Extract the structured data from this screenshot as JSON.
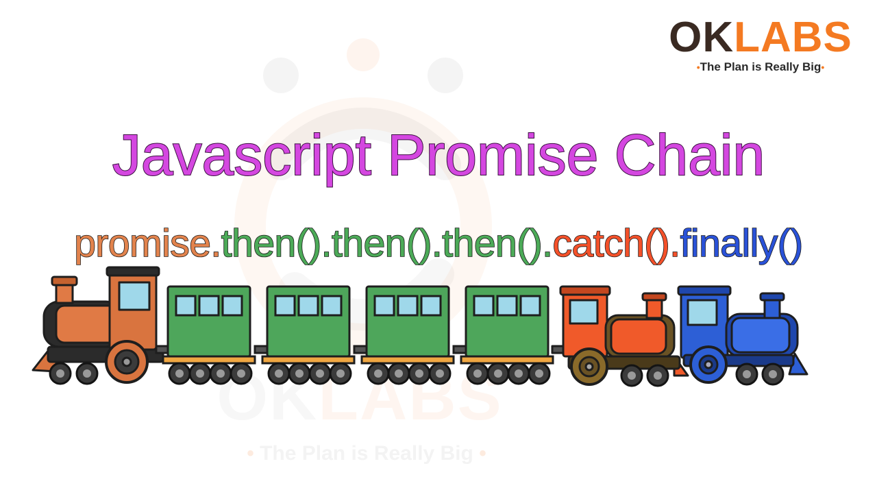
{
  "brand": {
    "name_part1": "OK",
    "name_part2": "LABS",
    "dot_left": "•",
    "tagline": "The Plan is Really Big",
    "dot_right": "•",
    "colors": {
      "dark": "#3a2a22",
      "orange": "#f47a22"
    }
  },
  "title": "Javascript Promise Chain",
  "chain": [
    {
      "text": "promise.",
      "color": "#e2834d"
    },
    {
      "text": "then().",
      "color": "#4caa58"
    },
    {
      "text": "then().",
      "color": "#4caa58"
    },
    {
      "text": "then().",
      "color": "#4caa58"
    },
    {
      "text": "catch().",
      "color": "#f4512a"
    },
    {
      "text": "finally()",
      "color": "#2a52d8"
    }
  ],
  "watermark": {
    "name_part1": "OK",
    "name_part2": "LABS",
    "dot_left": "•",
    "tagline": "The Plan is Really Big",
    "dot_right": "•"
  },
  "train": {
    "locomotive_color": "#e07a45",
    "carriage_color": "#4ea65b",
    "catch_engine_color": "#f05a2a",
    "finally_engine_color": "#2d5fd6",
    "carriage_count": 4
  }
}
